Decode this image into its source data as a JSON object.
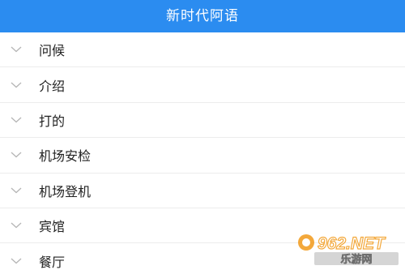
{
  "header": {
    "title": "新时代阿语"
  },
  "list": {
    "items": [
      {
        "label": "问候"
      },
      {
        "label": "介绍"
      },
      {
        "label": "打的"
      },
      {
        "label": "机场安检"
      },
      {
        "label": "机场登机"
      },
      {
        "label": "宾馆"
      },
      {
        "label": "餐厅"
      }
    ]
  },
  "watermark": {
    "domain_text": "962.NET",
    "site_text": "乐游网"
  },
  "colors": {
    "header_bg": "#2b8cf0",
    "chevron": "#b5b5b5",
    "divider": "#ececec"
  },
  "icons": {
    "expand": "chevron-down-icon"
  }
}
